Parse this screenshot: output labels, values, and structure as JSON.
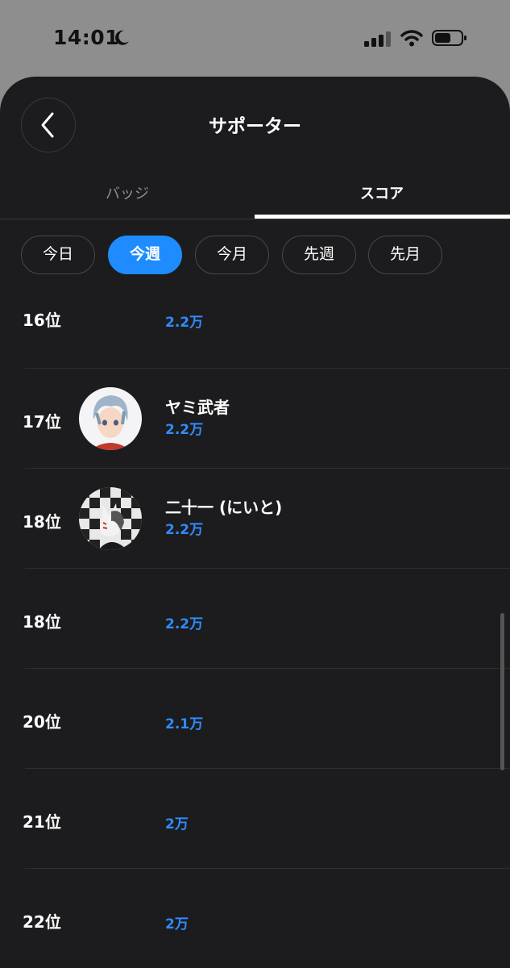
{
  "status_bar": {
    "time": "14:01",
    "icons": [
      "moon-icon",
      "signal-icon",
      "wifi-icon",
      "battery-icon"
    ]
  },
  "header": {
    "title": "サポーター",
    "back_icon": "chevron-left-icon"
  },
  "tabs": [
    {
      "label": "バッジ",
      "selected": false
    },
    {
      "label": "スコア",
      "selected": true
    }
  ],
  "filters": [
    {
      "label": "今日",
      "selected": false
    },
    {
      "label": "今週",
      "selected": true
    },
    {
      "label": "今月",
      "selected": false
    },
    {
      "label": "先週",
      "selected": false
    },
    {
      "label": "先月",
      "selected": false
    }
  ],
  "rankings": [
    {
      "rank": "16位",
      "name": "",
      "score": "2.2万"
    },
    {
      "rank": "17位",
      "name": "ヤミ武者",
      "score": "2.2万"
    },
    {
      "rank": "18位",
      "name": "二十一 (にいと)",
      "score": "2.2万"
    },
    {
      "rank": "18位",
      "name": "",
      "score": "2.2万"
    },
    {
      "rank": "20位",
      "name": "",
      "score": "2.1万"
    },
    {
      "rank": "21位",
      "name": "",
      "score": "2万"
    },
    {
      "rank": "22位",
      "name": "",
      "score": "2万"
    }
  ],
  "colors": {
    "accent": "#1e8cff",
    "sheet_background": "#1c1c1e",
    "score_text": "#2f8cff"
  }
}
